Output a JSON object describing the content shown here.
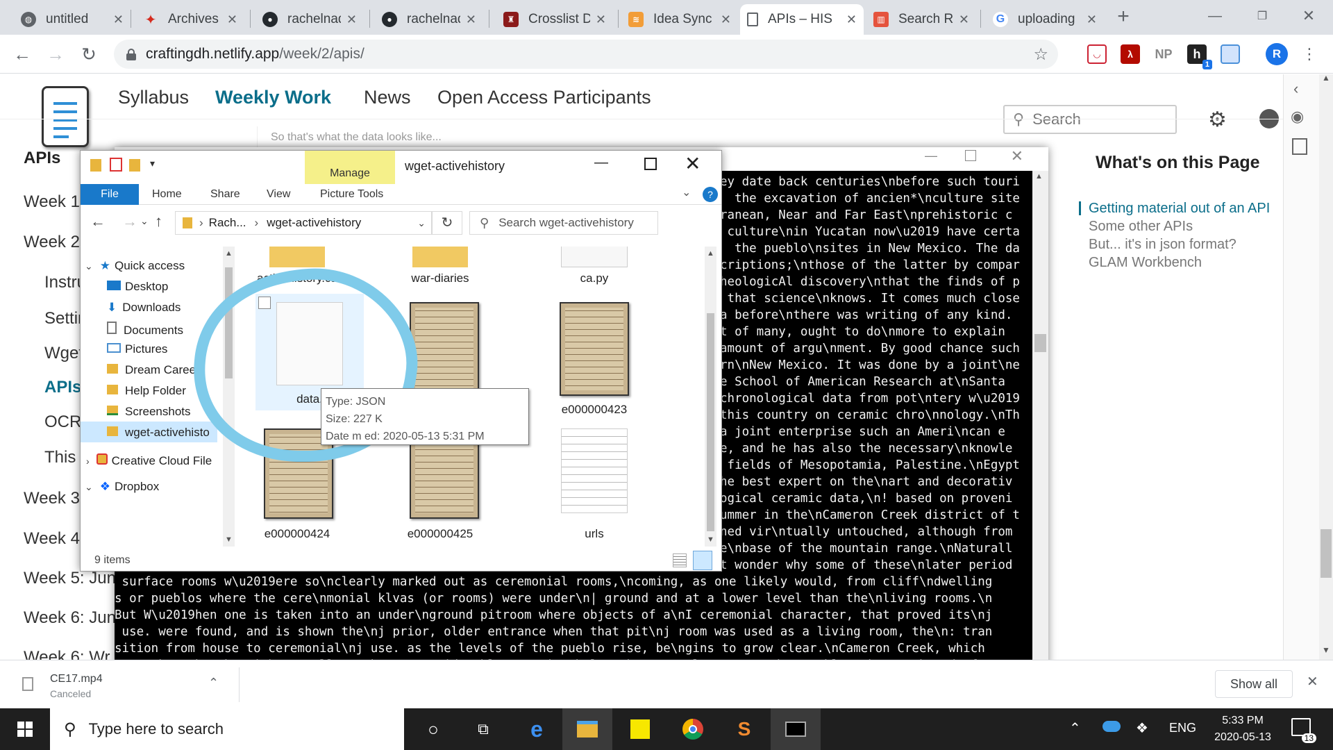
{
  "browser": {
    "tabs": [
      {
        "title": "untitled",
        "icon": "globe-icon"
      },
      {
        "title": "Archives Sp",
        "icon": "maple-leaf-icon"
      },
      {
        "title": "rachelnad",
        "icon": "github-icon"
      },
      {
        "title": "rachelnad",
        "icon": "github-icon"
      },
      {
        "title": "Crosslist D",
        "icon": "shield-crest-icon"
      },
      {
        "title": "Idea Sync",
        "icon": "rss-icon"
      },
      {
        "title": "APIs – HIS",
        "icon": "page-icon"
      },
      {
        "title": "Search Re",
        "icon": "loc-icon"
      },
      {
        "title": "uploading",
        "icon": "google-icon"
      }
    ],
    "new_tab": "+",
    "url_host": "craftingdh.netlify.app",
    "url_path": "/week/2/apis/",
    "extensions": [
      {
        "label": "",
        "icon": "pocket-icon"
      },
      {
        "label": "",
        "icon": "acrobat-icon"
      },
      {
        "label": "NP",
        "icon": "np-icon"
      },
      {
        "label": "h",
        "icon": "hypothesis-icon",
        "badge": "1"
      },
      {
        "label": "",
        "icon": "document-icon"
      }
    ],
    "profile_initial": "R"
  },
  "site": {
    "nav": [
      "Syllabus",
      "Weekly Work",
      "News",
      "Open Access Participants"
    ],
    "active_nav": "Weekly Work",
    "search_placeholder": "Search",
    "sidebar_title": "APIs",
    "sidebar": [
      "Week 1",
      "Week 2",
      "Instru",
      "Settin",
      "Wget",
      "APIs",
      "OCR",
      "This",
      "Week 3",
      "Week 4",
      "Week 5: Jun",
      "Week 6: Jun",
      "Week 6: Wr"
    ],
    "toc_heading": "What's on this Page",
    "toc": [
      "Getting material out of an API",
      "Some other APIs",
      "But... it's in json format?",
      "GLAM Workbench"
    ],
    "content_snippet": "So that's what the data looks like..."
  },
  "terminal": {
    "lines": [
      "ey date back centuries\\nbefore such touri",
      "  the excavation of ancien*\\nculture site",
      "ranean, Near and Far East\\nprehistoric c",
      " culture\\nin Yucatan now\\u2019 have certa",
      "  the pueblo\\nsites in New Mexico. The da",
      "criptions;\\nthose of the latter by compar",
      "heologicAl discovery\\nthat the finds of p",
      " that science\\nknows. It comes much close",
      "a before\\nthere was writing of any kind.",
      "t of many, ought to do\\nmore to explain",
      "amount of argu\\nment. By good chance such",
      "rn\\nNew Mexico. It was done by a joint\\ne",
      "e School of American Research at\\nSanta",
      "chronological data from pot\\ntery w\\u2019",
      "this country on ceramic chro\\nnology.\\nTh",
      "a joint enterprise such an Ameri\\ncan e",
      "e, and he has also the necessary\\nknowle",
      " fields of Mesopotamia, Palestine.\\nEgypt",
      "he best expert on the\\nart and decorativ",
      "ogical ceramic data,\\n! based on proveni",
      "ummer in the\\nCameron Creek district of t",
      "ned vir\\ntually untouched, although from",
      "e\\nbase of the mountain range.\\nNaturall",
      "t wonder why some of these\\nlater period"
    ],
    "bottom_lines": [
      " surface rooms w\\u2019ere so\\nclearly marked out as ceremonial rooms,\\ncoming, as one likely would, from cliff\\ndwelling",
      "s or pueblos where the cere\\nmonial klvas (or rooms) were under\\n| ground and at a lower level than the\\nliving rooms.\\n",
      "But W\\u2019hen one is taken into an under\\nground pitroom where objects of a\\nI ceremonial character, that proved its\\nj",
      " use. were found, and is shown the\\nj prior, older entrance when that pit\\nj room was used as a living room, the\\n: tran",
      "sition from house to ceremonial\\nj use. as the levels of the pueblo rise, be\\ngins to grow clear.\\nCameron Creek, which",
      "runs through\\nthe Mimbres Valley, show's considerable\\nerosion below the recently excavated'\\npueblo. The south end of t"
    ]
  },
  "explorer": {
    "title": "wget-activehistory",
    "manage_label": "Manage",
    "picture_tools": "Picture Tools",
    "ribbon_tabs": [
      "File",
      "Home",
      "Share",
      "View"
    ],
    "breadcrumb_parent": "Rach...",
    "breadcrumb_current": "wget-activehistory",
    "search_placeholder": "Search wget-activehistory",
    "quick_access_label": "Quick access",
    "nav_items": [
      {
        "label": "Desktop",
        "icon": "desktop-icon"
      },
      {
        "label": "Downloads",
        "icon": "download-arrow-icon"
      },
      {
        "label": "Documents",
        "icon": "documents-icon"
      },
      {
        "label": "Pictures",
        "icon": "pictures-icon"
      },
      {
        "label": "Dream Career",
        "icon": "folder-icon"
      },
      {
        "label": "Help Folder",
        "icon": "folder-icon"
      },
      {
        "label": "Screenshots",
        "icon": "folder-sync-icon"
      },
      {
        "label": "wget-activehisto",
        "icon": "folder-icon"
      },
      {
        "label": "Creative Cloud File",
        "icon": "creative-cloud-icon"
      },
      {
        "label": "Dropbox",
        "icon": "dropbox-icon"
      }
    ],
    "files": [
      {
        "name": "activehistory.ca",
        "kind": "folder"
      },
      {
        "name": "war-diaries",
        "kind": "folder"
      },
      {
        "name": "ca.py",
        "kind": "file"
      },
      {
        "name": "data.",
        "kind": "json"
      },
      {
        "name": "",
        "kind": "image-hidden"
      },
      {
        "name": "e000000423",
        "kind": "image"
      },
      {
        "name": "e000000424",
        "kind": "image"
      },
      {
        "name": "e000000425",
        "kind": "image"
      },
      {
        "name": "urls",
        "kind": "text"
      }
    ],
    "tooltip": {
      "type": "Type: JSON",
      "size": "Size: 227 K",
      "date": "Date m",
      "date_rest": "ed: 2020-05-13 5:31 PM"
    },
    "status": "9 items"
  },
  "downloads": {
    "file": "CE17.mp4",
    "status": "Canceled",
    "show_all": "Show all"
  },
  "taskbar": {
    "search_placeholder": "Type here to search",
    "lang": "ENG",
    "time": "5:33 PM",
    "date": "2020-05-13",
    "notification_count": "13",
    "apps": [
      "cortana-icon",
      "task-view-icon",
      "edge-icon",
      "file-explorer-icon",
      "sticky-notes-icon",
      "chrome-icon",
      "sublime-icon",
      "terminal-icon"
    ]
  },
  "colors": {
    "accent": "#0b6e8a",
    "highlight_circle": "#7fcbea",
    "tooltip_border": "#767676"
  }
}
